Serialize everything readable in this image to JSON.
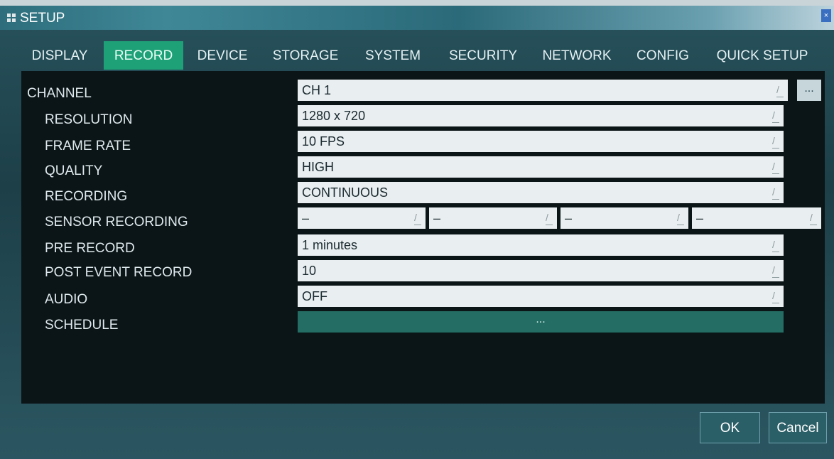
{
  "window": {
    "title": "SETUP",
    "close_symbol": "×"
  },
  "tabs": [
    {
      "label": "DISPLAY"
    },
    {
      "label": "RECORD"
    },
    {
      "label": "DEVICE"
    },
    {
      "label": "STORAGE"
    },
    {
      "label": "SYSTEM"
    },
    {
      "label": "SECURITY"
    },
    {
      "label": "NETWORK"
    },
    {
      "label": "CONFIG"
    },
    {
      "label": "QUICK SETUP"
    }
  ],
  "active_tab": "RECORD",
  "settings": {
    "channel": {
      "label": "CHANNEL",
      "value": "CH 1",
      "more": "..."
    },
    "resolution": {
      "label": "RESOLUTION",
      "value": "1280 x 720"
    },
    "frame_rate": {
      "label": "FRAME RATE",
      "value": "10 FPS"
    },
    "quality": {
      "label": "QUALITY",
      "value": "HIGH"
    },
    "recording": {
      "label": "RECORDING",
      "value": "CONTINUOUS"
    },
    "sensor_recording": {
      "label": "SENSOR RECORDING",
      "values": [
        "–",
        "–",
        "–",
        "–"
      ]
    },
    "pre_record": {
      "label": "PRE RECORD",
      "value": "1 minutes"
    },
    "post_event_record": {
      "label": "POST EVENT RECORD",
      "value": "10"
    },
    "audio": {
      "label": "AUDIO",
      "value": "OFF"
    },
    "schedule": {
      "label": "SCHEDULE",
      "button": "..."
    }
  },
  "footer": {
    "ok": "OK",
    "cancel": "Cancel"
  },
  "colors": {
    "active_tab": "#1fa178",
    "panel": "#0b1417",
    "window": "#27525c"
  }
}
